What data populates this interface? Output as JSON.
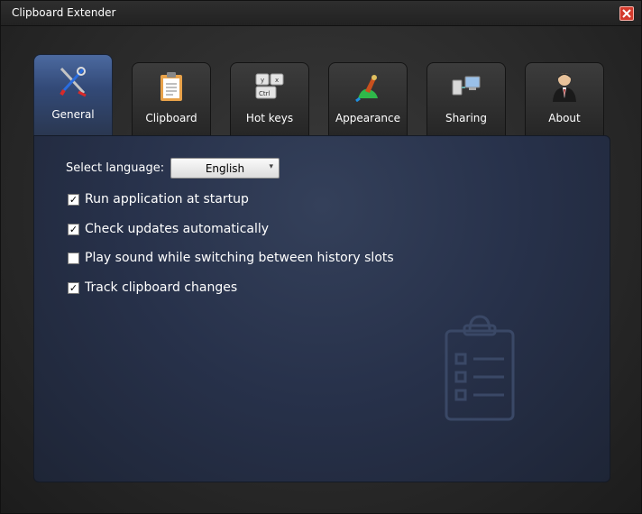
{
  "window": {
    "title": "Clipboard Extender"
  },
  "tabs": [
    {
      "label": "General",
      "icon": "tools-icon",
      "active": true
    },
    {
      "label": "Clipboard",
      "icon": "clipboard-icon",
      "active": false
    },
    {
      "label": "Hot keys",
      "icon": "keyboard-icon",
      "active": false
    },
    {
      "label": "Appearance",
      "icon": "paint-icon",
      "active": false
    },
    {
      "label": "Sharing",
      "icon": "network-icon",
      "active": false
    },
    {
      "label": "About",
      "icon": "user-icon",
      "active": false
    }
  ],
  "general": {
    "language_label": "Select language:",
    "language_value": "English",
    "options": [
      {
        "label": "Run application at startup",
        "checked": true
      },
      {
        "label": "Check updates automatically",
        "checked": true
      },
      {
        "label": "Play sound while switching between history slots",
        "checked": false
      },
      {
        "label": "Track clipboard changes",
        "checked": true
      }
    ]
  },
  "colors": {
    "active_tab": "#3e5789",
    "panel": "#27314a",
    "close": "#d33a2c"
  }
}
